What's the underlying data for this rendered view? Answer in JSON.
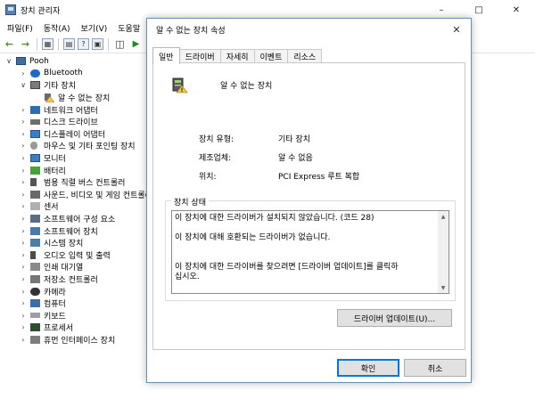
{
  "device_manager": {
    "title": "장치 관리자",
    "menu": [
      "파일(F)",
      "동작(A)",
      "보기(V)",
      "도움말"
    ],
    "tree": [
      {
        "label": "Pooh",
        "level": 0,
        "expander": "expanded",
        "icon": "computer-icon"
      },
      {
        "label": "Bluetooth",
        "level": 1,
        "expander": "collapsed",
        "icon": "bluetooth-icon"
      },
      {
        "label": "기타 장치",
        "level": 1,
        "expander": "expanded",
        "icon": "misc-device-icon"
      },
      {
        "label": "알 수 없는 장치",
        "level": 2,
        "expander": "none",
        "icon": "warning-device-icon"
      },
      {
        "label": "네트워크 어댑터",
        "level": 1,
        "expander": "collapsed",
        "icon": "network-adapter-icon"
      },
      {
        "label": "디스크 드라이브",
        "level": 1,
        "expander": "collapsed",
        "icon": "disk-drive-icon"
      },
      {
        "label": "디스플레이 어댑터",
        "level": 1,
        "expander": "collapsed",
        "icon": "display-adapter-icon"
      },
      {
        "label": "마우스 및 기타 포인팅 장치",
        "level": 1,
        "expander": "collapsed",
        "icon": "mouse-icon"
      },
      {
        "label": "모니터",
        "level": 1,
        "expander": "collapsed",
        "icon": "monitor-icon"
      },
      {
        "label": "배터리",
        "level": 1,
        "expander": "collapsed",
        "icon": "battery-icon"
      },
      {
        "label": "범용 직렬 버스 컨트롤러",
        "level": 1,
        "expander": "collapsed",
        "icon": "usb-icon"
      },
      {
        "label": "사운드, 비디오 및 게임 컨트롤러",
        "level": 1,
        "expander": "collapsed",
        "icon": "audio-icon"
      },
      {
        "label": "센서",
        "level": 1,
        "expander": "collapsed",
        "icon": "sensor-icon"
      },
      {
        "label": "소프트웨어 구성 요소",
        "level": 1,
        "expander": "collapsed",
        "icon": "software-component-icon"
      },
      {
        "label": "소프트웨어 장치",
        "level": 1,
        "expander": "collapsed",
        "icon": "software-device-icon"
      },
      {
        "label": "시스템 장치",
        "level": 1,
        "expander": "collapsed",
        "icon": "system-device-icon"
      },
      {
        "label": "오디오 입력 및 출력",
        "level": 1,
        "expander": "collapsed",
        "icon": "microphone-icon"
      },
      {
        "label": "인쇄 대기열",
        "level": 1,
        "expander": "collapsed",
        "icon": "print-queue-icon"
      },
      {
        "label": "저장소 컨트롤러",
        "level": 1,
        "expander": "collapsed",
        "icon": "storage-controller-icon"
      },
      {
        "label": "카메라",
        "level": 1,
        "expander": "collapsed",
        "icon": "camera-icon"
      },
      {
        "label": "컴퓨터",
        "level": 1,
        "expander": "collapsed",
        "icon": "pc-icon"
      },
      {
        "label": "키보드",
        "level": 1,
        "expander": "collapsed",
        "icon": "keyboard-icon"
      },
      {
        "label": "프로세서",
        "level": 1,
        "expander": "collapsed",
        "icon": "processor-icon"
      },
      {
        "label": "휴먼 인터페이스 장치",
        "level": 1,
        "expander": "collapsed",
        "icon": "hid-icon"
      }
    ]
  },
  "dialog": {
    "title": "알 수 없는 장치 속성",
    "tabs": [
      "일반",
      "드라이버",
      "자세히",
      "이벤트",
      "리소스"
    ],
    "device_name": "알 수 없는 장치",
    "properties": {
      "type_label": "장치 유형:",
      "type_value": "기타 장치",
      "manufacturer_label": "제조업체:",
      "manufacturer_value": "알 수 없음",
      "location_label": "위치:",
      "location_value": "PCI Express 루트 복합"
    },
    "status": {
      "legend": "장치 상태",
      "text": "이 장치에 대한 드라이버가 설치되지 않았습니다. (코드 28)\n\n이 장치에 대해 호환되는 드라이버가 없습니다.\n\n\n이 장치에 대한 드라이버를 찾으려면 [드라이버 업데이트]를 클릭하\n십시오."
    },
    "update_button": "드라이버 업데이트(U)...",
    "ok_button": "확인",
    "cancel_button": "취소"
  }
}
